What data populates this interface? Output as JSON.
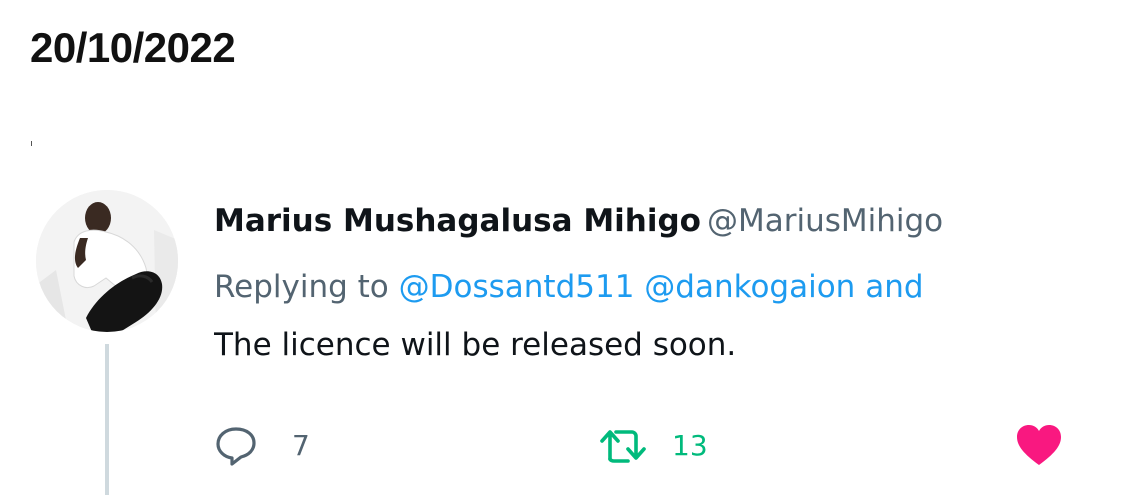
{
  "date": "20/10/2022",
  "tweet": {
    "display_name": "Marius Mushagalusa Mihigo",
    "handle": "@MariusMihigo",
    "reply_prefix": "Replying to",
    "mentions": [
      "@Dossantd511",
      "@dankogaion",
      "and"
    ],
    "text": "The licence will be released soon.",
    "stats": {
      "replies": "7",
      "retweets": "13"
    }
  },
  "colors": {
    "mention": "#1d9bf0",
    "retweet_active": "#00ba7c",
    "like_active": "#f91880",
    "muted": "#536471"
  },
  "icons": {
    "reply": "reply-icon",
    "retweet": "retweet-icon",
    "like": "heart-icon"
  }
}
